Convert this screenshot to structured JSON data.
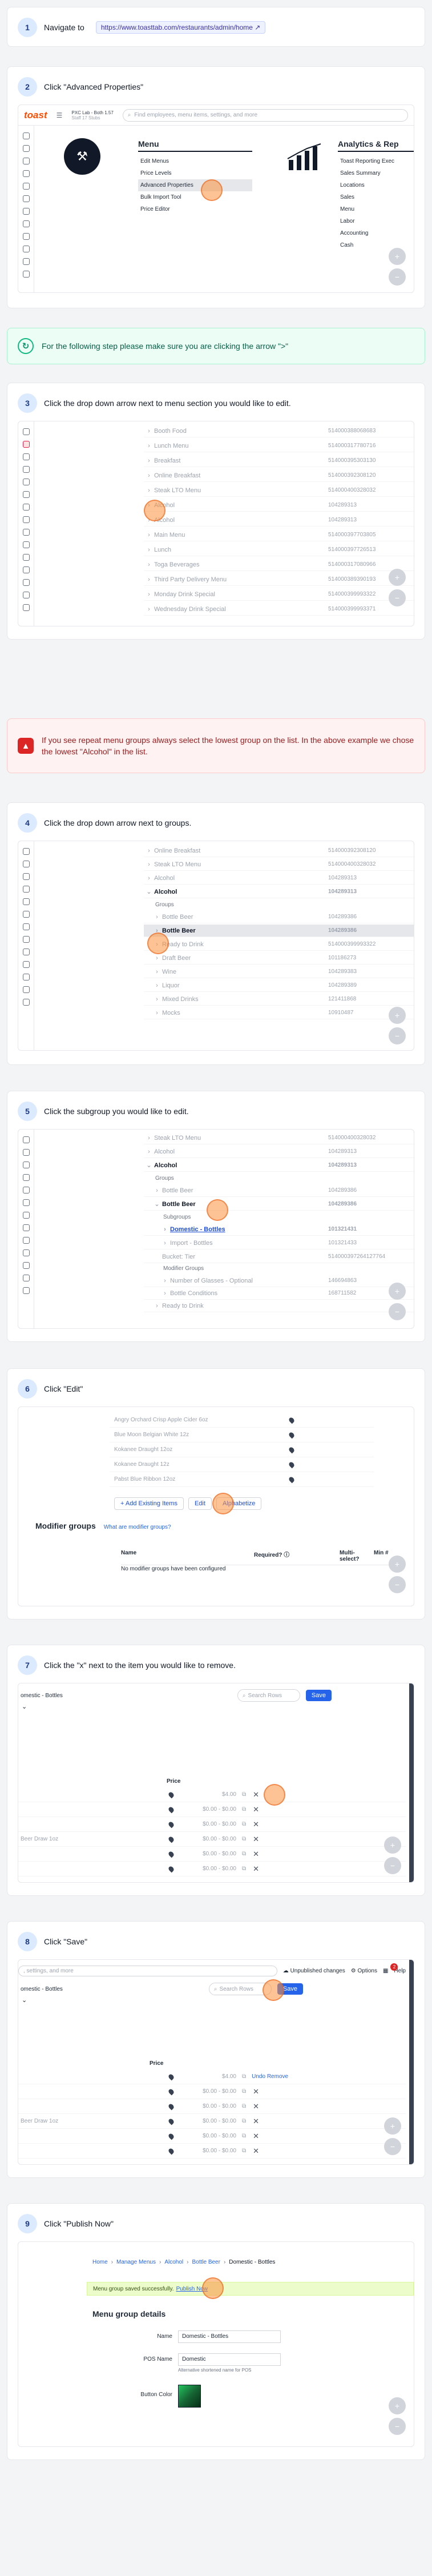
{
  "steps": {
    "s1": {
      "num": "1",
      "text": "Navigate to",
      "url": "https://www.toasttab.com/restaurants/admin/home"
    },
    "s2": {
      "num": "2",
      "text": "Click \"Advanced Properties\""
    },
    "s3": {
      "num": "3",
      "text": "Click the drop down arrow next to menu section you would like to edit."
    },
    "s4": {
      "num": "4",
      "text": "Click the drop down arrow next to groups."
    },
    "s5": {
      "num": "5",
      "text": "Click the subgroup you would like to edit."
    },
    "s6": {
      "num": "6",
      "text": "Click \"Edit\""
    },
    "s7": {
      "num": "7",
      "text": "Click the \"x\" next to the item you would like to remove."
    },
    "s8": {
      "num": "8",
      "text": "Click \"Save\""
    },
    "s9": {
      "num": "9",
      "text": "Click \"Publish Now\""
    }
  },
  "callouts": {
    "info": "For the following step please make sure you are clicking the arrow \">\"",
    "warn": "If you see repeat menu groups always select the lowest group on the list. In the above example we chose the lowest \"Alcohol\" in the list."
  },
  "shot2": {
    "brand": "toast",
    "location": "PXC Lab - Both 1.57",
    "location_sub": "Staff 17 Stubs",
    "search_placeholder": "Find employees, menu items, settings, and more",
    "menu_title": "Menu",
    "menu_items": [
      "Edit Menus",
      "Price Levels",
      "Advanced Properties",
      "Bulk Import Tool",
      "Price Editor"
    ],
    "analytics_title": "Analytics & Rep",
    "analytics_items": [
      "Toast Reporting Exec",
      "Sales Summary",
      "Locations",
      "Sales",
      "Menu",
      "Labor",
      "Accounting",
      "Cash"
    ]
  },
  "shot3": {
    "rows": [
      {
        "name": "Booth Food",
        "id": "514000388068683"
      },
      {
        "name": "Lunch Menu",
        "id": "514000317780716"
      },
      {
        "name": "Breakfast",
        "id": "514000395303130"
      },
      {
        "name": "Online Breakfast",
        "id": "514000392308120"
      },
      {
        "name": "Steak LTO Menu",
        "id": "514000400328032"
      },
      {
        "name": "Alcohol",
        "id": "104289313"
      },
      {
        "name": "Alcohol",
        "id": "104289313"
      },
      {
        "name": "Main Menu",
        "id": "514000397703805"
      },
      {
        "name": "Lunch",
        "id": "514000397726513"
      },
      {
        "name": "Toga Beverages",
        "id": "514000317080966"
      },
      {
        "name": "Third Party Delivery Menu",
        "id": "514000389390193"
      },
      {
        "name": "Monday Drink Special",
        "id": "514000399993322"
      },
      {
        "name": "Wednesday Drink Special",
        "id": "514000399993371"
      }
    ]
  },
  "shot4": {
    "rows": [
      {
        "name": "Online Breakfast",
        "id": "514000392308120"
      },
      {
        "name": "Steak LTO Menu",
        "id": "514000400328032"
      },
      {
        "name": "Alcohol",
        "id": "104289313"
      },
      {
        "name": "Alcohol",
        "id": "104289313"
      }
    ],
    "groups_label": "Groups",
    "groups": [
      {
        "name": "Bottle Beer",
        "id": "104289386"
      },
      {
        "name": "Bottle Beer",
        "id": "104289386"
      },
      {
        "name": "Ready to Drink",
        "id": "514000399993322"
      },
      {
        "name": "Draft Beer",
        "id": "101186273"
      },
      {
        "name": "Wine",
        "id": "104289383"
      },
      {
        "name": "Liquor",
        "id": "104289389"
      },
      {
        "name": "Mixed Drinks",
        "id": "121411868"
      },
      {
        "name": "Mocks",
        "id": "10910487"
      }
    ]
  },
  "shot5": {
    "rows": [
      {
        "name": "Steak LTO Menu",
        "id": "514000400328032"
      },
      {
        "name": "Alcohol",
        "id": "104289313"
      },
      {
        "name": "Alcohol",
        "id": "104289313"
      }
    ],
    "groups_label": "Groups",
    "groups": [
      {
        "name": "Bottle Beer",
        "id": "104289386"
      },
      {
        "name": "Bottle Beer",
        "id": "104289386"
      }
    ],
    "subgroups_label": "Subgroups",
    "subgroups": [
      {
        "name": "Domestic - Bottles",
        "id": "101321431"
      },
      {
        "name": "Import - Bottles",
        "id": "101321433"
      }
    ],
    "bucket": {
      "name": "Bucket: Tier",
      "id": "514000397264127764"
    },
    "modifier_label": "Modifier Groups",
    "modifiers": [
      {
        "name": "Number of Glasses - Optional",
        "id": "146694863"
      },
      {
        "name": "Bottle Conditions",
        "id": "168711582"
      }
    ],
    "last": {
      "name": "Ready to Drink",
      "id": ""
    }
  },
  "shot6": {
    "items": [
      "Angry Orchard Crisp Apple Cider 6oz",
      "Blue Moon Belgian White 12z",
      "Kokanee Draught 12oz",
      "Kokanee Draught 12z",
      "Pabst Blue Ribbon 12oz"
    ],
    "add_label": "+ Add Existing Items",
    "edit_label": "Edit",
    "alpha_label": "Alphabetize",
    "modifier_title": "Modifier groups",
    "modifier_link": "What are modifier groups?",
    "col_name": "Name",
    "col_required": "Required?",
    "col_multi": "Multi-select?",
    "col_min": "Min #",
    "empty": "No modifier groups have been configured"
  },
  "shot7": {
    "breadcrumb": "omestic - Bottles",
    "search_placeholder": "Search Rows",
    "save_label": "Save",
    "price_label": "Price",
    "left_items": [
      "",
      "",
      "",
      "Beer Draw 1oz",
      "",
      ""
    ],
    "prices": [
      "$4.00",
      "$0.00 - $0.00",
      "$0.00 - $0.00",
      "$0.00 - $0.00",
      "$0.00 - $0.00",
      "$0.00 - $0.00"
    ]
  },
  "shot8": {
    "top_search": ", settings, and more",
    "unpublished": "Unpublished changes",
    "options": "Options",
    "help": "Help",
    "badge": "2",
    "breadcrumb": "omestic - Bottles",
    "search_placeholder": "Search Rows",
    "save_label": "Save",
    "price_label": "Price",
    "undo_label": "Undo Remove",
    "left_items": [
      "",
      "",
      "",
      "Beer Draw 1oz",
      ""
    ],
    "prices": [
      "$4.00",
      "$0.00 - $0.00",
      "$0.00 - $0.00",
      "$0.00 - $0.00",
      "$0.00 - $0.00",
      "$0.00 - $0.00"
    ]
  },
  "shot9": {
    "crumbs": [
      "Home",
      "Manage Menus",
      "Alcohol",
      "Bottle Beer",
      "Domestic - Bottles"
    ],
    "banner": "Menu group saved successfully.",
    "publish": "Publish Now",
    "section": "Menu group details",
    "name_label": "Name",
    "name_value": "Domestic - Bottles",
    "pos_label": "POS Name",
    "pos_value": "Domestic",
    "pos_hint": "Alternative shortened name for POS",
    "color_label": "Button Color"
  },
  "zoom": {
    "in": "+",
    "out": "−"
  },
  "colors": {
    "accent": "#2563eb",
    "toast_orange": "#ff4c00",
    "highlight": "#fb923c"
  }
}
